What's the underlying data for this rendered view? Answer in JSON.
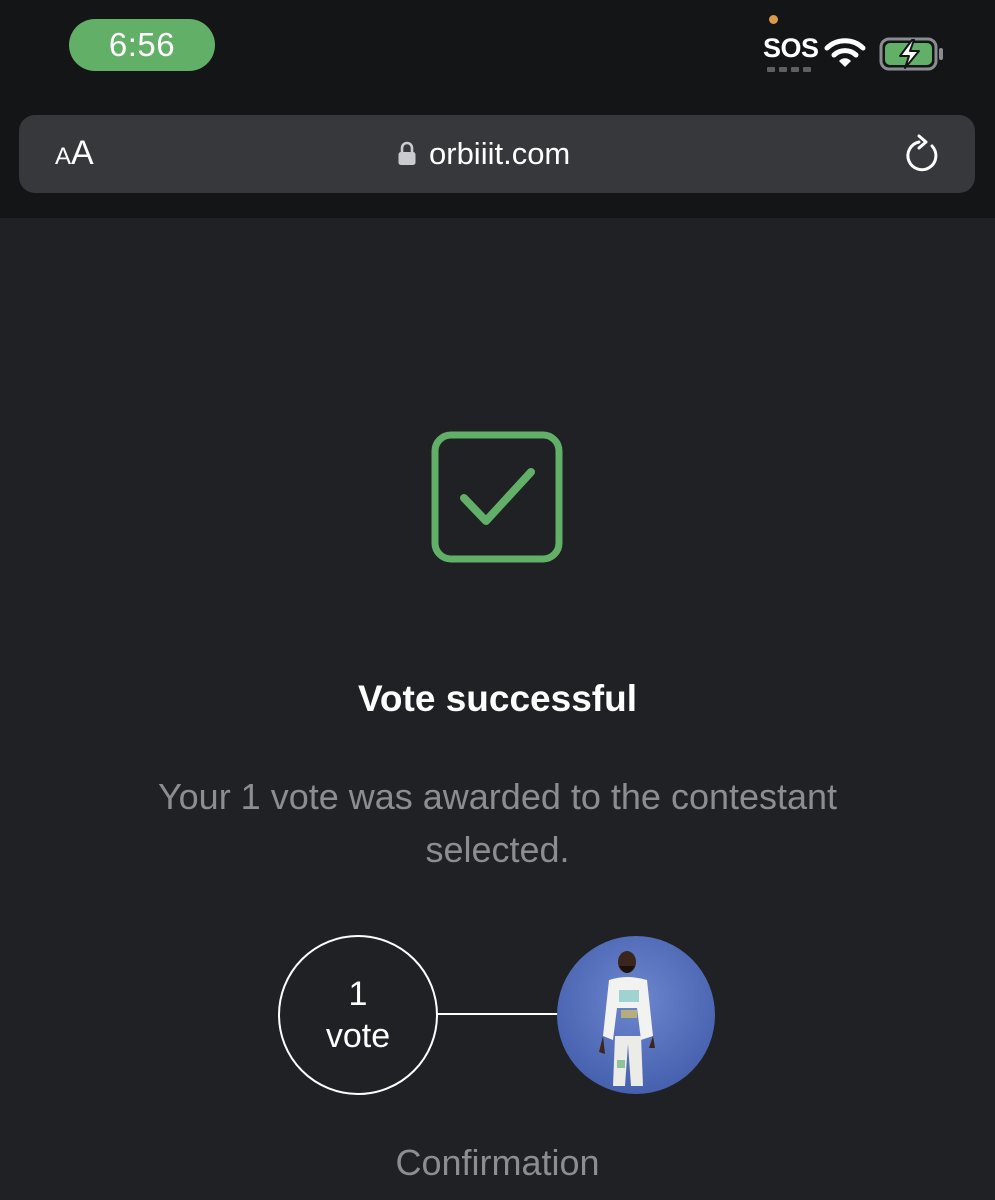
{
  "status_bar": {
    "time": "6:56",
    "carrier": "SOS",
    "accent_color": "#62b068",
    "icons": [
      "wifi-icon",
      "battery-charging-icon"
    ]
  },
  "address_bar": {
    "text_size_small": "A",
    "text_size_large": "A",
    "url": "orbiiit.com",
    "icons": [
      "lock-icon",
      "reload-icon"
    ]
  },
  "result": {
    "icon": "checkmark-icon",
    "icon_color": "#62b068",
    "title": "Vote successful",
    "message": "Your 1 vote was awarded to the contestant selected."
  },
  "vote_summary": {
    "count": "1",
    "unit": "vote",
    "caption": "Confirmation"
  }
}
